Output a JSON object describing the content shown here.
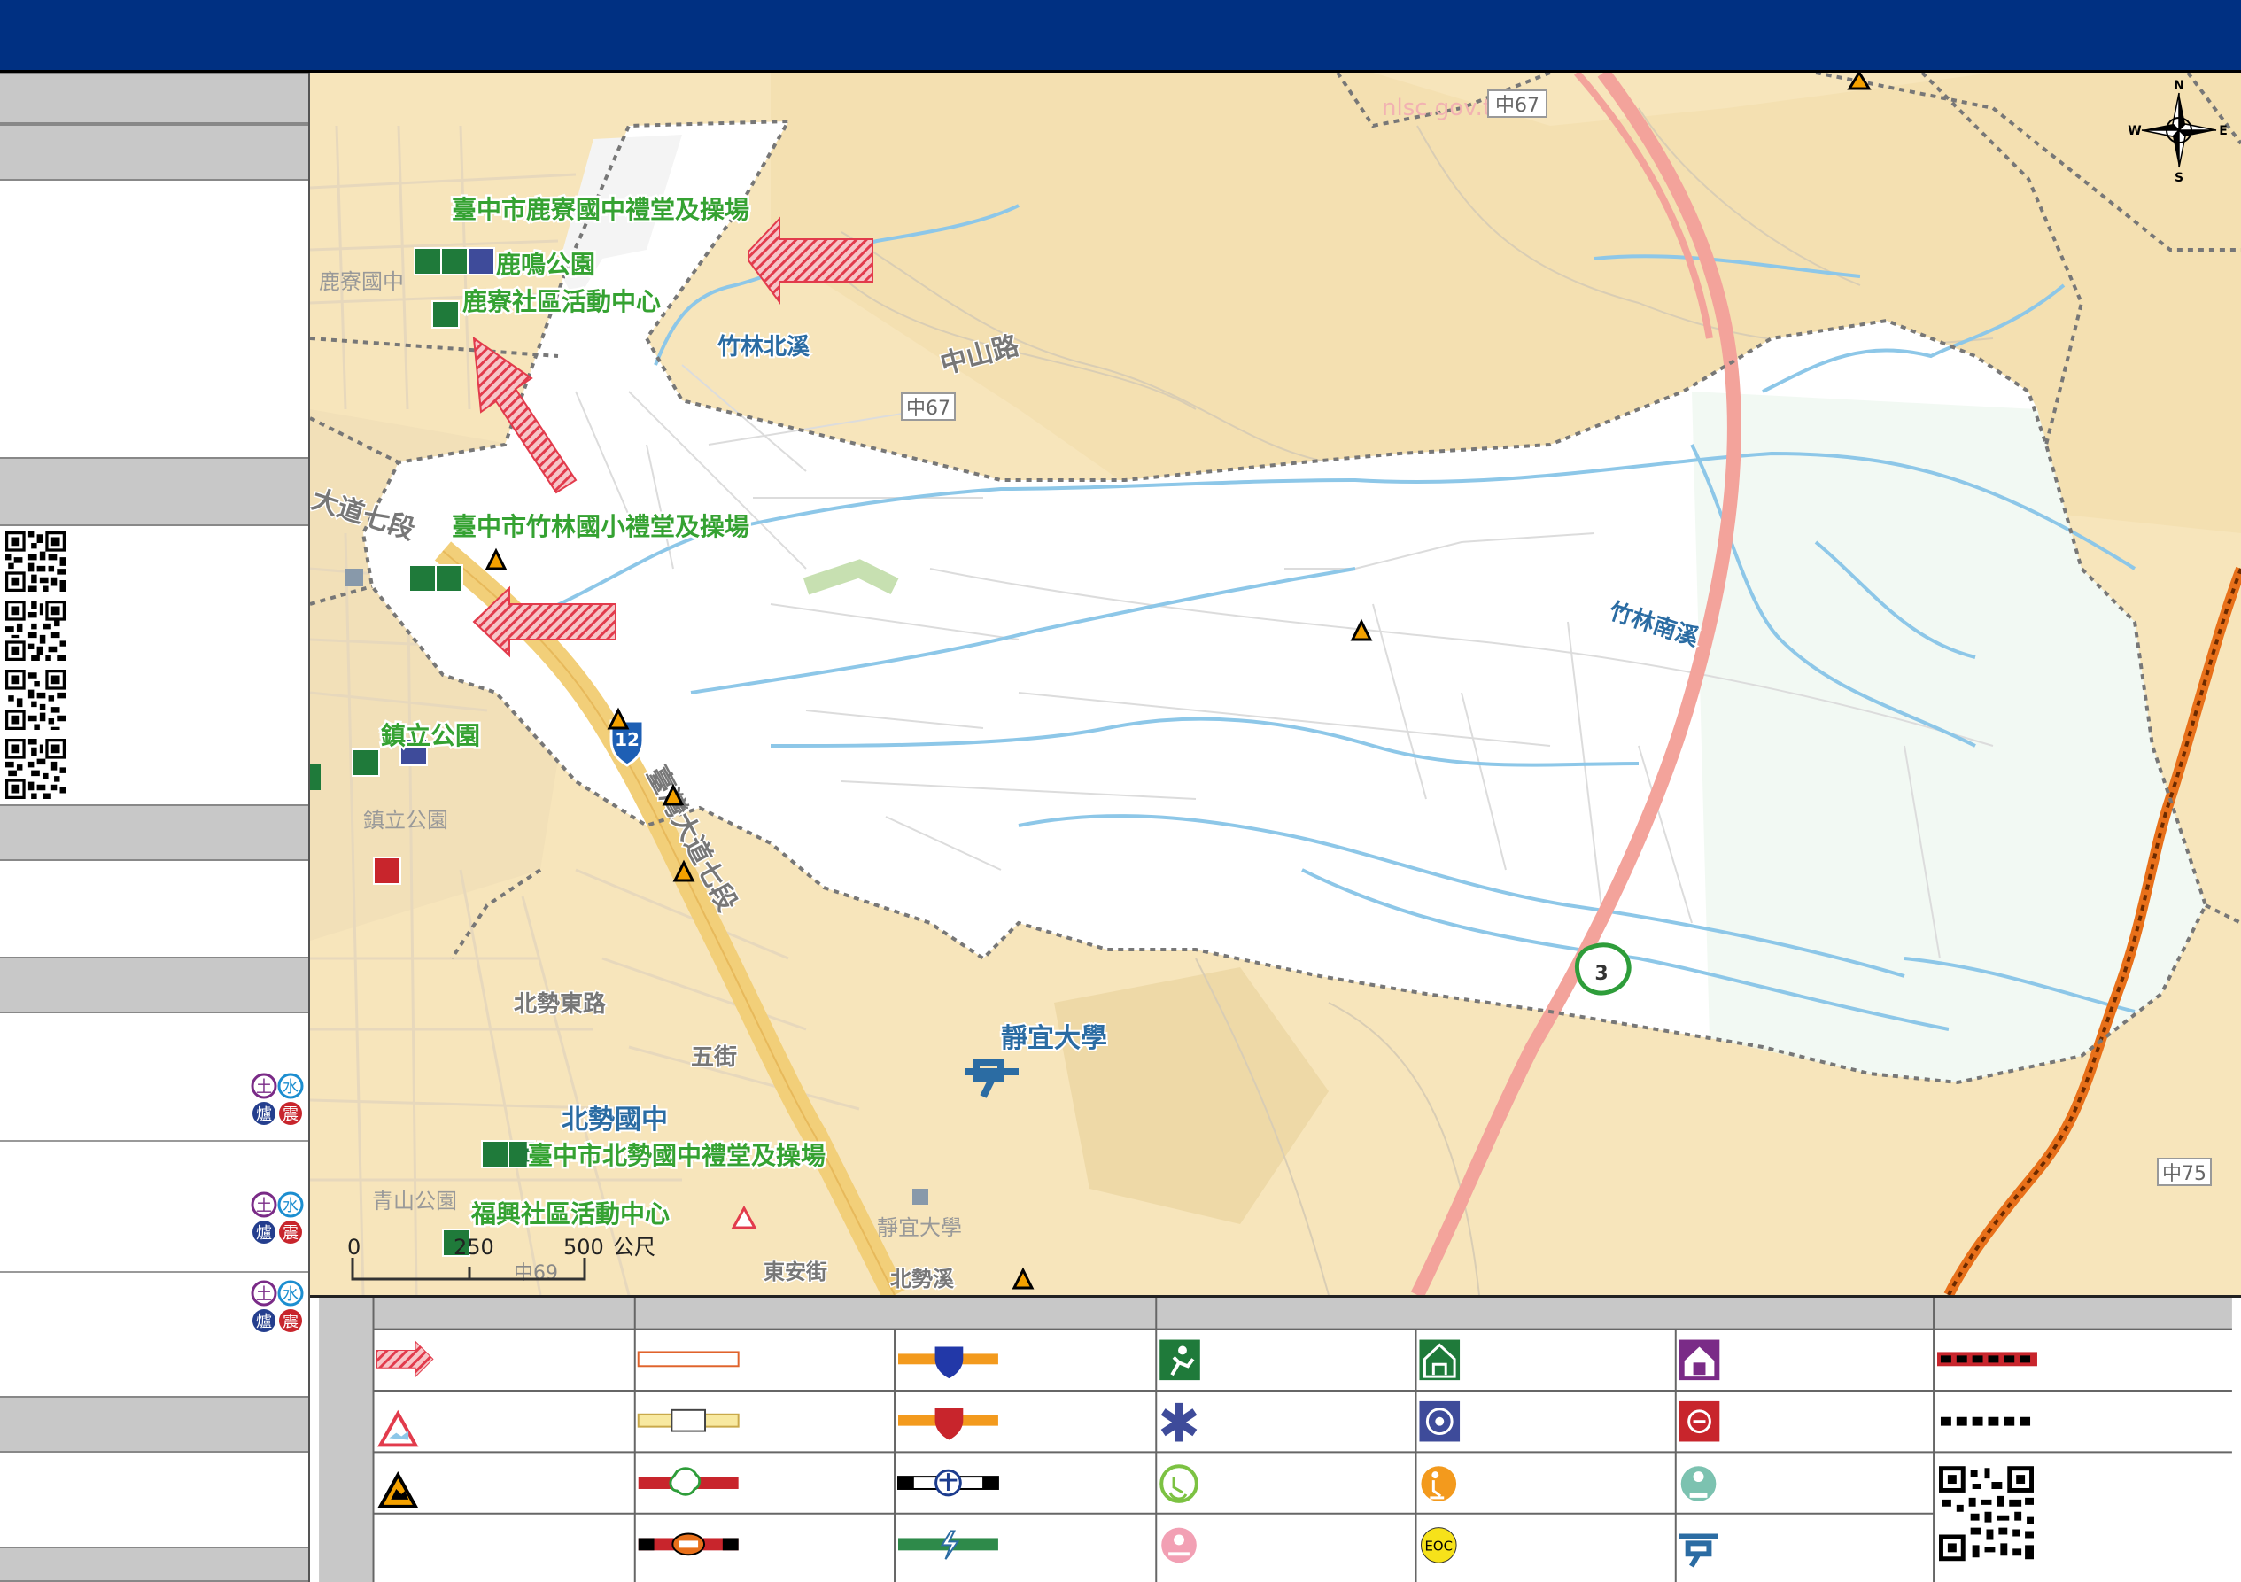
{
  "map_labels": {
    "shelter_luliao_junior": "臺中市鹿寮國中禮堂及操場",
    "park_luming": "鹿鳴公園",
    "center_luliao": "鹿寮社區活動中心",
    "shelter_zhulin_elem": "臺中市竹林國小禮堂及操場",
    "park_zhenli": "鎮立公園",
    "jingyi_univ": "靜宜大學",
    "beishi_junior": "北勢國中",
    "shelter_beishi_junior": "臺中市北勢國中禮堂及操場",
    "center_fuxing": "福興社區活動中心"
  },
  "basemap_text": {
    "watermark": "nlsc.gov.tw",
    "zhong67_top": "中67",
    "zhong67_mid": "中67",
    "zhong75": "中75",
    "zhong69": "中69",
    "zhulin_north_creek": "竹林北溪",
    "zhulin_south_creek": "竹林南溪",
    "zhongshan_rd": "中山路",
    "dadao_7_a": "大道七段",
    "dadao_7_b": "臺灣大道七段",
    "luliao_junior_small": "鹿寮國中",
    "zhenli_park_small": "鎮立公園",
    "beishi_east_rd": "北勢東路",
    "wu_st": "五街",
    "qingshan_park": "青山公園",
    "jingyi_small": "靜宜大學",
    "dongan_rd": "東安街",
    "beishi_creek": "北勢溪",
    "road_3": "3",
    "road_12": "12"
  },
  "scale_bar": {
    "t0": "0",
    "t1": "250",
    "t2": "500",
    "unit": "公尺"
  },
  "compass": {
    "n": "N",
    "s": "S",
    "e": "E",
    "w": "W"
  },
  "legend_icons": [
    "evacuation-arrow-icon",
    "landslide-warning-icon",
    "rockfall-warning-icon",
    "provincial-road-icon",
    "county-road-icon",
    "township-road-icon",
    "expressway-icon",
    "national-highway-icon",
    "national-highway-red-icon",
    "railway-icon",
    "hsr-icon",
    "outdoor-shelter-icon",
    "medical-icon",
    "elderly-care-icon",
    "childcare-icon",
    "indoor-shelter-icon",
    "police-icon",
    "disabled-care-icon",
    "eoc-icon",
    "women-shelter-icon",
    "fire-station-icon",
    "preschool-icon",
    "helicopter-icon",
    "admin-boundary-orange-icon",
    "admin-boundary-black-icon",
    "qr-code-icon"
  ],
  "legend_eoc": "EOC",
  "hazard_badges": {
    "soil": "土",
    "water": "水",
    "ash": "爐",
    "quake": "震"
  },
  "colors": {
    "topbar": "#003082",
    "shelter_green": "#1f7a3a",
    "label_green": "#35a232",
    "arrow_red": "#e83a4a",
    "boundary_dots": "#777777",
    "river_blue": "#8dc7e8",
    "hsr_pink": "#f3a39b",
    "basemap_cream": "#f7e5bb"
  }
}
